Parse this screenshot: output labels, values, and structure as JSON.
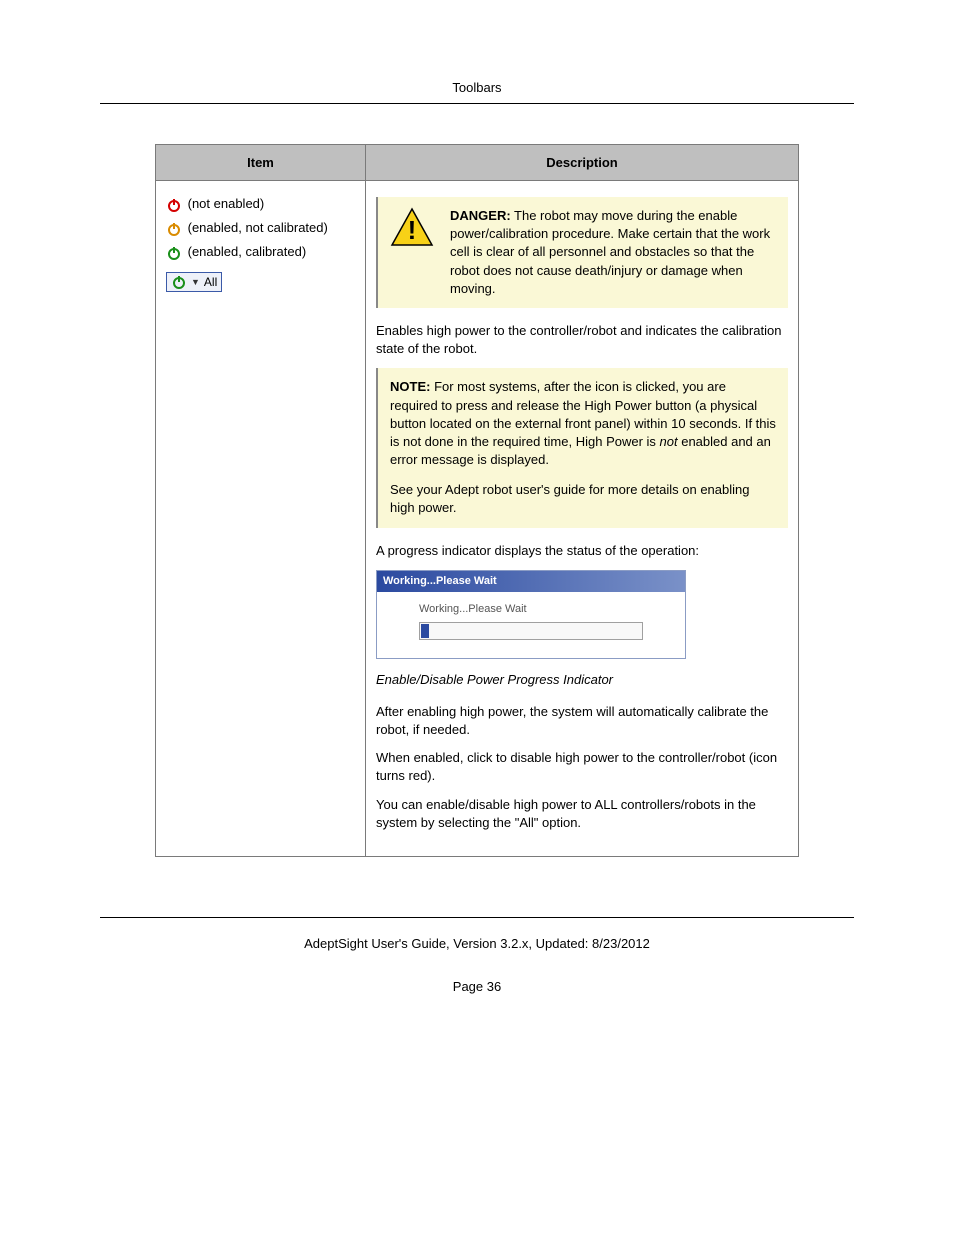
{
  "header": {
    "title": "Toolbars"
  },
  "table": {
    "headers": {
      "item": "Item",
      "desc": "Description"
    },
    "item": {
      "state_not_enabled": "(not enabled)",
      "state_enabled_not_cal": "(enabled, not calibrated)",
      "state_enabled_cal": "(enabled, calibrated)",
      "all_label": "All"
    },
    "desc": {
      "danger_label": "DANGER:",
      "danger_text": " The robot may move during the enable power/calibration procedure. Make certain that the work cell is clear of all personnel and obstacles so that the robot does not cause death/injury or damage when moving.",
      "enables_text": "Enables high power to the controller/robot and indicates the calibration state of the robot.",
      "note_label": "NOTE:",
      "note_text_1": " For most systems, after the icon is clicked, you are required to press and release the High Power button (a physical button located on the external front panel) within 10 seconds. If this is not done in the required time, High Power is ",
      "note_em": "not",
      "note_text_2": " enabled and an error message is displayed.",
      "note_see": "See your Adept robot user's guide for more details on enabling high power.",
      "progress_intro": "A progress indicator displays the status of the operation:",
      "progress_title": "Working...Please Wait",
      "progress_body": "Working...Please Wait",
      "caption": "Enable/Disable Power Progress Indicator",
      "after_enable": "After enabling high power, the system will automatically calibrate the robot, if needed.",
      "when_enabled": "When enabled, click to disable high power to the controller/robot (icon turns red).",
      "all_option": "You can enable/disable high power to ALL controllers/robots in the system by selecting the \"All\" option."
    }
  },
  "footer": {
    "guide": "AdeptSight User's Guide,  Version 3.2.x, Updated: 8/23/2012",
    "page": "Page 36"
  }
}
